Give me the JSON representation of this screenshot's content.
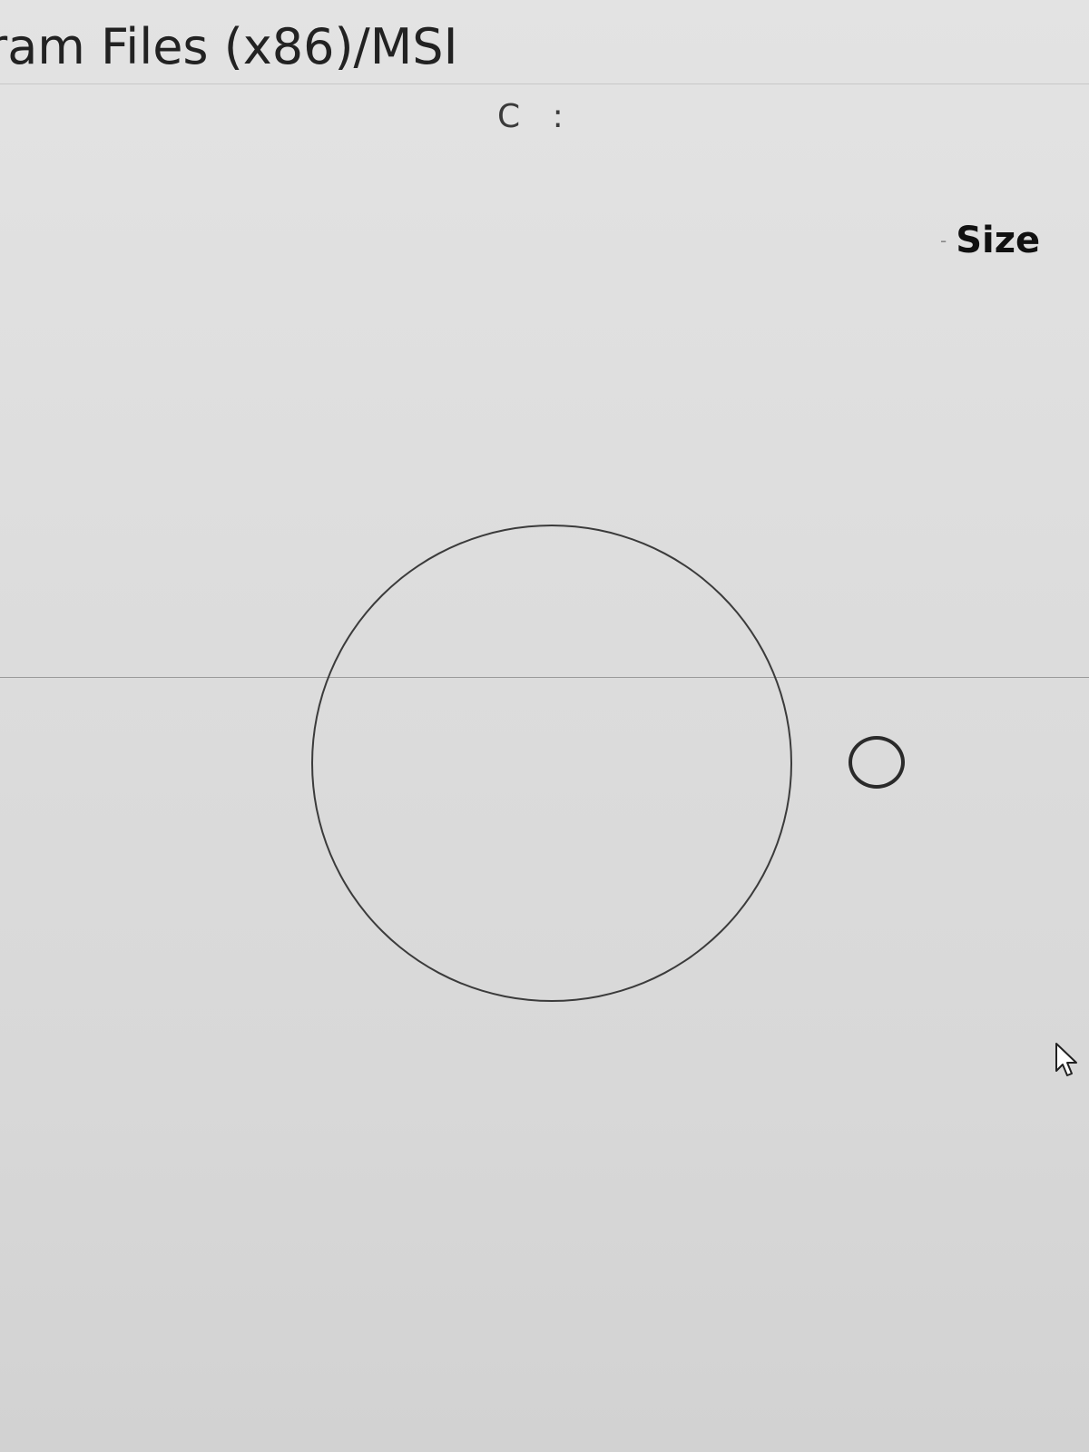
{
  "address_bar": {
    "path": "ram Files (x86)/MSI"
  },
  "drive": {
    "label": "C :"
  },
  "columns": {
    "size_header": "Size",
    "sort_indicator": "-"
  },
  "icons": {
    "cursor": "mouse-pointer-icon",
    "large_circle": "circle-outline-icon",
    "radio": "radio-button-icon"
  },
  "colors": {
    "background": "#dcdcdc",
    "text": "#1a1a1a",
    "divider": "#9a9a9a"
  }
}
